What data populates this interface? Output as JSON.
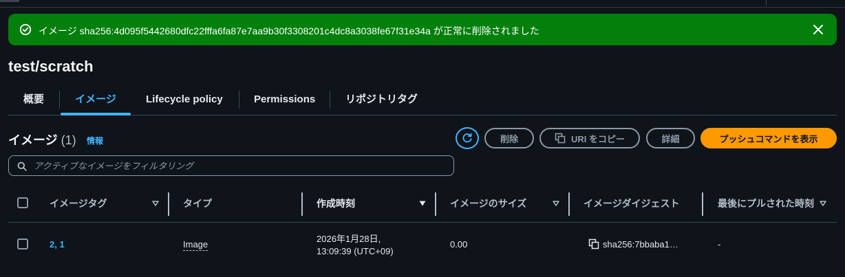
{
  "flash": {
    "message": "イメージ sha256:4d095f5442680dfc22fffa6fa87e7aa9b30f3308201c4dc8a3038fe67f31e34a が正常に削除されました",
    "status_color": "#037f0c",
    "icon": "check-circle-icon",
    "close_icon": "close-icon"
  },
  "page": {
    "title": "test/scratch"
  },
  "tabs": [
    {
      "label": "概要"
    },
    {
      "label": "イメージ",
      "active": true
    },
    {
      "label": "Lifecycle policy"
    },
    {
      "label": "Permissions"
    },
    {
      "label": "リポジトリタグ"
    }
  ],
  "section": {
    "title": "イメージ",
    "count": "(1)",
    "info_label": "情報"
  },
  "actions": {
    "refresh_icon": "refresh-icon",
    "delete_label": "削除",
    "copy_uri_label": "URI をコピー",
    "details_label": "詳細",
    "push_label": "プッシュコマンドを表示"
  },
  "search": {
    "placeholder": "アクティブなイメージをフィルタリング",
    "value": ""
  },
  "table": {
    "columns": [
      {
        "label": "イメージタグ"
      },
      {
        "label": "タイプ"
      },
      {
        "label": "作成時刻"
      },
      {
        "label": "イメージのサイズ"
      },
      {
        "label": "イメージダイジェスト"
      },
      {
        "label": "最後にプルされた時刻"
      }
    ],
    "rows": [
      {
        "tags": "2, 1",
        "type": "Image",
        "created_line1": "2026年1月28日,",
        "created_line2": "13:09:39 (UTC+09)",
        "size": "0.00",
        "digest": "sha256:7bbaba1…",
        "last_pulled": "-"
      }
    ]
  },
  "colors": {
    "background": "#0f141a",
    "accent": "#42b4ff",
    "primary_button": "#ff9900",
    "success": "#037f0c"
  }
}
